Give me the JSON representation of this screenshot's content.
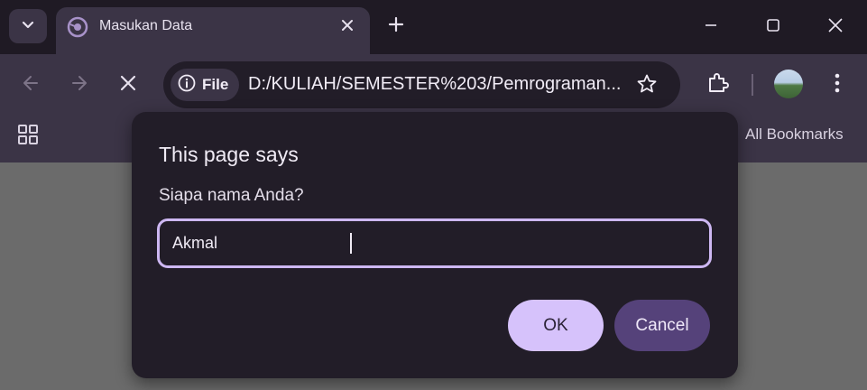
{
  "window": {
    "active_tab_title": "Masukan Data",
    "new_tab_label": "+"
  },
  "toolbar": {
    "site_chip_label": "File",
    "url": "D:/KULIAH/SEMESTER%203/Pemrograman..."
  },
  "bookmarks_bar": {
    "all_bookmarks_label": "All Bookmarks"
  },
  "dialog": {
    "title": "This page says",
    "message": "Siapa nama Anda?",
    "input_value": "Akmal",
    "ok_label": "OK",
    "cancel_label": "Cancel"
  },
  "colors": {
    "tabstrip_bg": "#1f1a24",
    "toolbar_bg": "#3b3446",
    "dialog_bg": "#221d28",
    "input_border": "#cdb7f2",
    "ok_bg": "#d6c2fb",
    "cancel_bg": "#55427a",
    "page_bg": "#6b6b6b"
  },
  "icons": [
    "chevron-down-icon",
    "favicon-icon",
    "close-icon",
    "plus-icon",
    "minimize-icon",
    "maximize-icon",
    "back-icon",
    "forward-icon",
    "stop-icon",
    "info-icon",
    "star-icon",
    "extensions-icon",
    "avatar",
    "more-vert-icon",
    "apps-grid-icon"
  ]
}
